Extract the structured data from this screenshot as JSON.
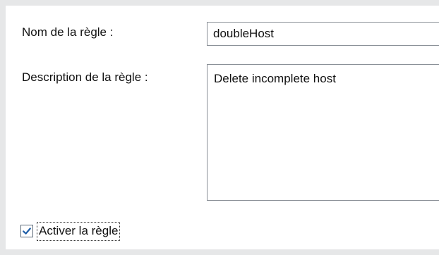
{
  "form": {
    "rule_name_label": "Nom de la règle :",
    "rule_name_value": "doubleHost",
    "rule_description_label": "Description de la règle :",
    "rule_description_value": "Delete incomplete host",
    "activate_rule_label": "Activer la règle",
    "activate_rule_checked": true
  },
  "icons": {
    "checkbox": "checkmark-icon"
  },
  "colors": {
    "background": "#e6e7e8",
    "panel": "#ffffff",
    "border": "#8a9097",
    "checkmark": "#1f5fa8"
  }
}
